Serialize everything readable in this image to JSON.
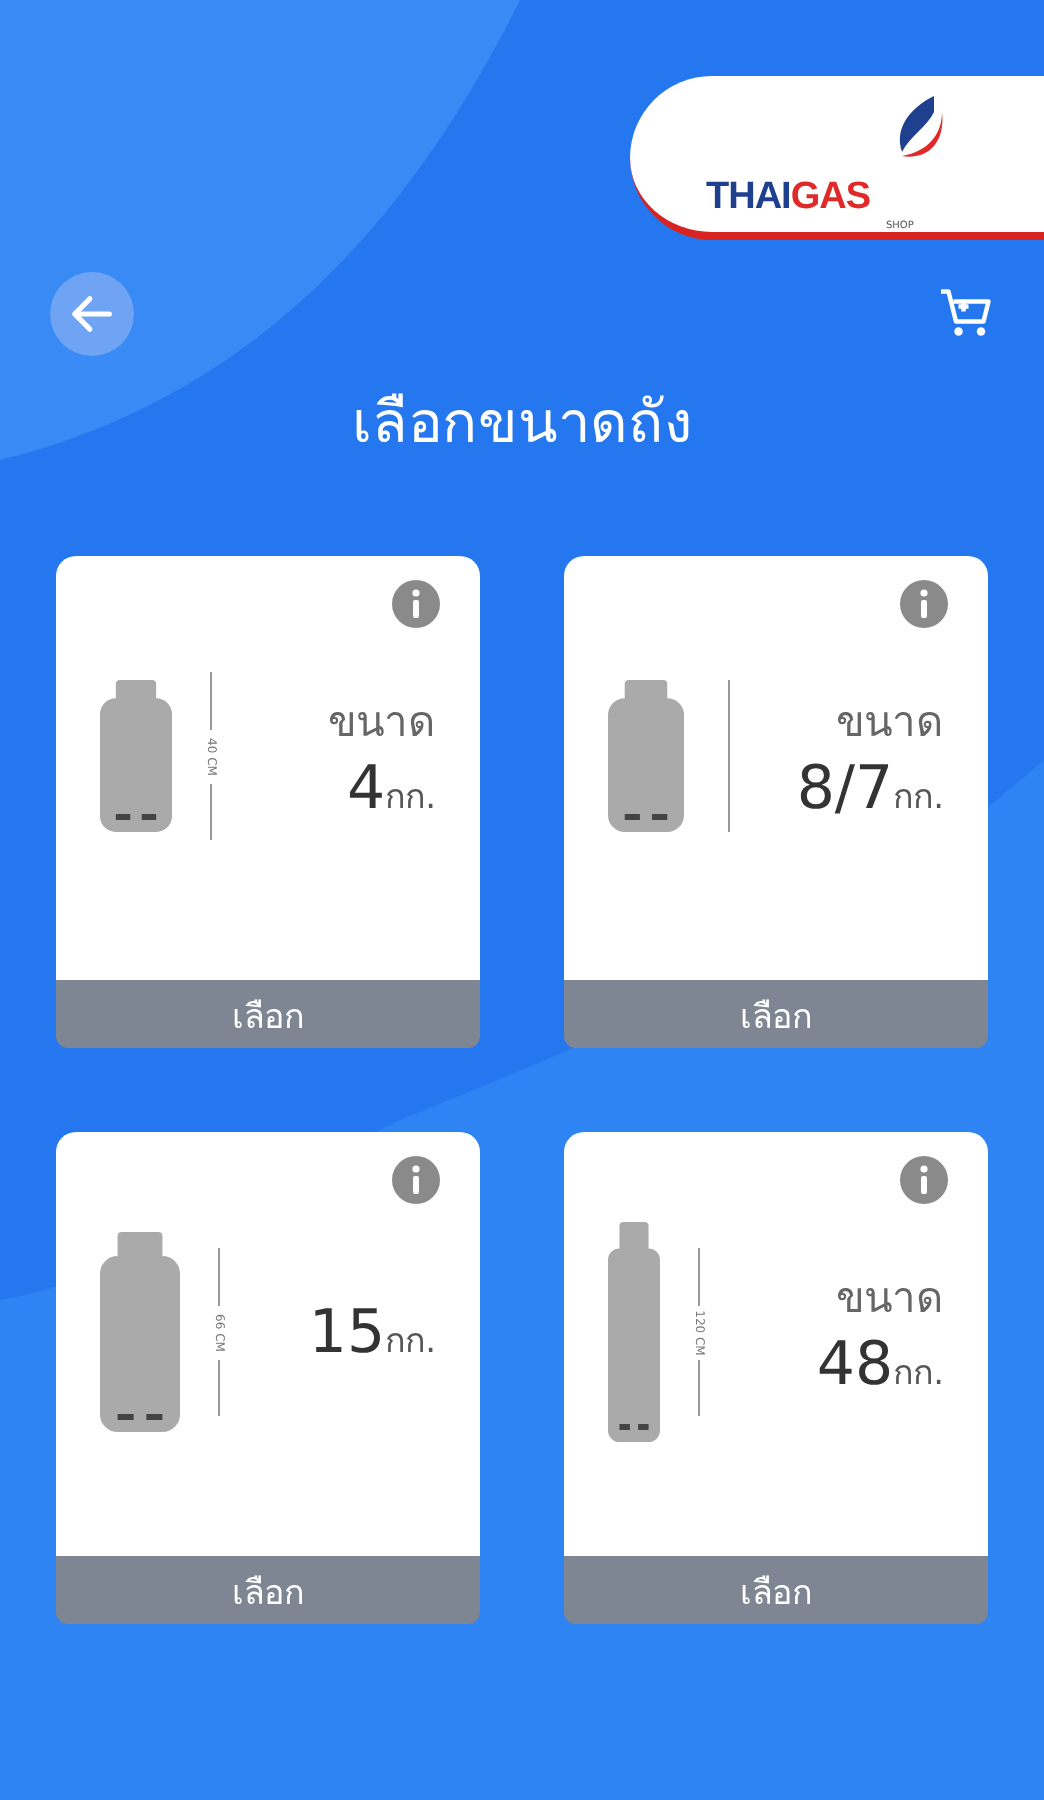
{
  "header": {
    "logo": {
      "first": "THAI",
      "second": "GAS",
      "sub": "SHOP"
    }
  },
  "title": "เลือกขนาดถัง",
  "tanks": [
    {
      "kind": "short",
      "height": "40 CM",
      "size_label": "ขนาด",
      "size": "4",
      "unit": "กก.",
      "button": "เลือก"
    },
    {
      "kind": "round",
      "size_label": "ขนาด",
      "size": "8/7",
      "unit": "กก.",
      "button": "เลือก"
    },
    {
      "kind": "long",
      "height": "66 CM",
      "size": "15",
      "unit": "กก.",
      "button": "เลือก"
    },
    {
      "kind": "tall",
      "height": "120 CM",
      "size_label": "ขนาด",
      "size": "48",
      "unit": "กก.",
      "button": "เลือก"
    }
  ]
}
